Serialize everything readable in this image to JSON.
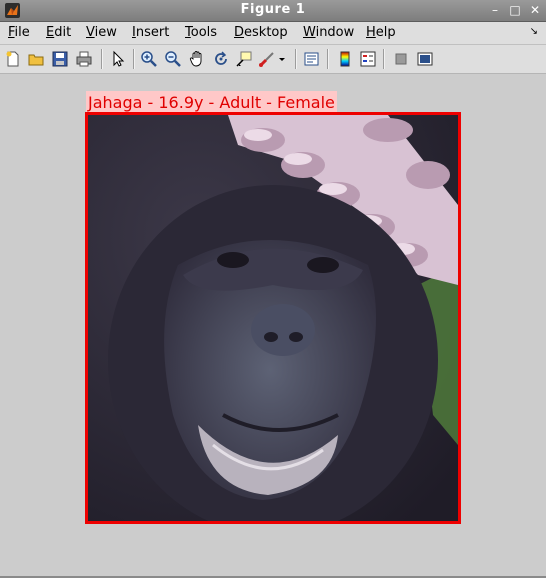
{
  "window": {
    "title": "Figure 1"
  },
  "menubar": {
    "items": [
      "File",
      "Edit",
      "View",
      "Insert",
      "Tools",
      "Desktop",
      "Window",
      "Help"
    ],
    "underline": [
      "F",
      "E",
      "V",
      "I",
      "T",
      "D",
      "W",
      "H"
    ]
  },
  "toolbar": {
    "buttons": [
      "new-figure",
      "open-file",
      "save-figure",
      "print-figure",
      "edit-plot",
      "zoom-in",
      "zoom-out",
      "pan",
      "rotate-3d",
      "data-cursor",
      "brush",
      "link-plot",
      "insert-colorbar",
      "insert-legend",
      "hide-plot-tools",
      "show-plot-tools"
    ]
  },
  "figure": {
    "title": "Jahaga - 16.9y - Adult - Female",
    "title_color": "#e00000",
    "title_background": "#ffc8c8",
    "frame_color": "#ee0000",
    "image_subject": "chimpanzee face photograph"
  }
}
